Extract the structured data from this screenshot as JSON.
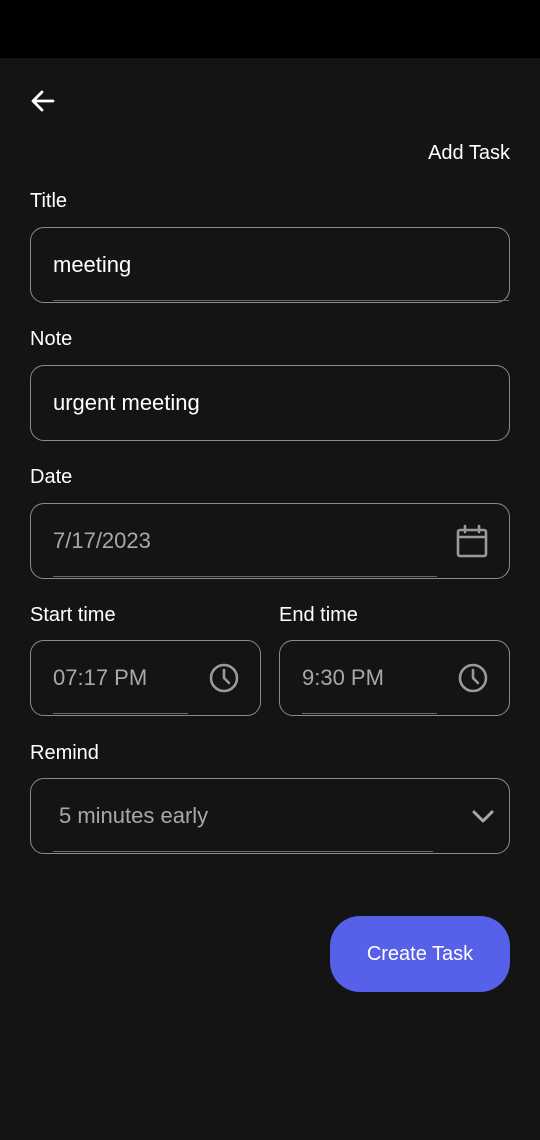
{
  "header": {
    "title": "Add Task"
  },
  "form": {
    "title": {
      "label": "Title",
      "value": "meeting"
    },
    "note": {
      "label": "Note",
      "value": "urgent meeting"
    },
    "date": {
      "label": "Date",
      "value": "7/17/2023",
      "icon": "calendar-icon"
    },
    "start_time": {
      "label": "Start time",
      "value": "07:17 PM",
      "icon": "clock-icon"
    },
    "end_time": {
      "label": "End time",
      "value": "9:30 PM",
      "icon": "clock-icon"
    },
    "remind": {
      "label": "Remind",
      "value": "5 minutes early",
      "icon": "chevron-down-icon"
    }
  },
  "actions": {
    "create_label": "Create Task"
  },
  "colors": {
    "background": "#141414",
    "status_bar": "#000000",
    "accent": "#5760e8",
    "border": "#8a8a8a",
    "muted_text": "#a8a8a8"
  }
}
